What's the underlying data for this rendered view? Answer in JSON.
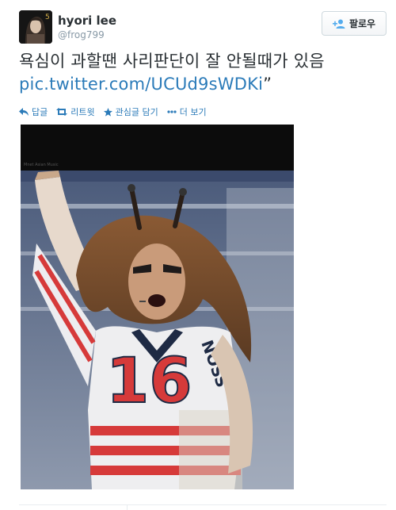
{
  "user": {
    "name": "hyori lee",
    "handle": "@frog799",
    "avatar_badge": "5"
  },
  "follow_button": {
    "label": "팔로우"
  },
  "tweet": {
    "text": "욕심이 과할땐 사리판단이 잘 안될때가 있음",
    "link": "pic.twitter.com/UCUd9sWDKi",
    "trailing": "”"
  },
  "actions": {
    "reply": "답글",
    "retweet": "리트윗",
    "favorite": "관심글 담기",
    "more": "더 보기"
  },
  "media": {
    "screen_caption": "Mnet Asian Music",
    "jersey_number": "16",
    "jersey_text": "NOSS"
  },
  "colors": {
    "link": "#2b7bb9",
    "text": "#292f33",
    "muted": "#8899a6",
    "stripe_red": "#d63a3a"
  },
  "icons": {
    "reply": "reply-arrow-icon",
    "retweet": "retweet-icon",
    "favorite": "star-icon",
    "more": "ellipsis-icon",
    "follow": "add-user-icon"
  }
}
